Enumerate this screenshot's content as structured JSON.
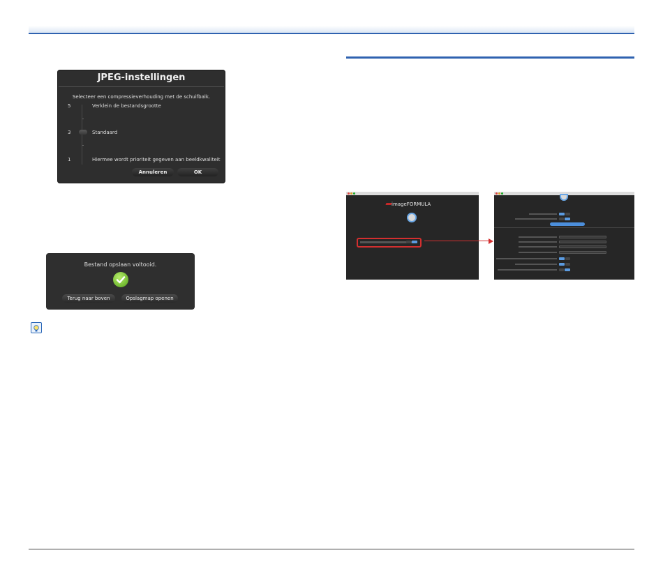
{
  "jpeg_dialog": {
    "title": "JPEG-instellingen",
    "instruction": "Selecteer een compressieverhouding met de schuifbalk.",
    "scale": [
      {
        "num": "5",
        "label": "Verklein de bestandsgrootte"
      },
      {
        "num": "3",
        "label": "Standaard"
      },
      {
        "num": "1",
        "label": "Hiermee wordt prioriteit gegeven aan beeldkwaliteit"
      }
    ],
    "slider_value": 3,
    "cancel_label": "Annuleren",
    "ok_label": "OK"
  },
  "save_dialog": {
    "message": "Bestand opslaan voltooid.",
    "back_label": "Terug naar boven",
    "open_folder_label": "Opslagmap openen"
  },
  "icons": {
    "tip": "lightbulb-icon",
    "check": "checkmark-icon"
  },
  "colors": {
    "accent": "#2f62b0",
    "callout": "#d32f2f",
    "dialog_bg": "#2e2e2e"
  },
  "screenshot1": {
    "logo": "imageFORMULA"
  }
}
